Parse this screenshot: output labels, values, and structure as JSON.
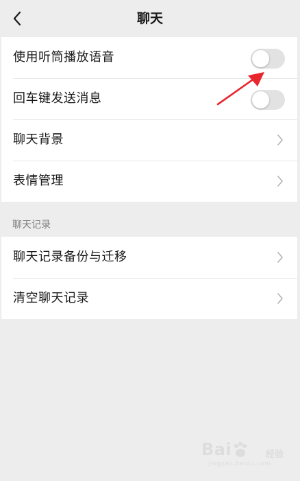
{
  "navbar": {
    "title": "聊天",
    "back_icon": "chevron-left-icon"
  },
  "settings_group": {
    "items": [
      {
        "label": "使用听筒播放语音",
        "control": "toggle",
        "enabled": false
      },
      {
        "label": "回车键发送消息",
        "control": "toggle",
        "enabled": false
      },
      {
        "label": "聊天背景",
        "control": "chevron-right-icon"
      },
      {
        "label": "表情管理",
        "control": "chevron-right-icon"
      }
    ]
  },
  "history_section": {
    "header": "聊天记录",
    "items": [
      {
        "label": "聊天记录备份与迁移",
        "control": "chevron-right-icon"
      },
      {
        "label": "清空聊天记录",
        "control": "chevron-right-icon"
      }
    ]
  },
  "annotation": {
    "color": "#e8262e",
    "icon": "red-arrow-icon"
  },
  "watermark": {
    "brand": "Bai",
    "sub": "经验",
    "url": "jingyan.baidu.com"
  },
  "colors": {
    "background": "#ededed",
    "card": "#ffffff",
    "toggle_off": "#e2e2e2",
    "text": "#191919",
    "section_header": "#7f7f7f"
  }
}
